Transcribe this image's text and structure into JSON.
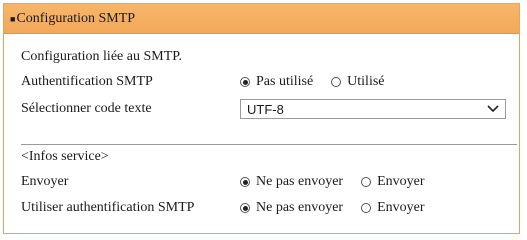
{
  "panel": {
    "title": "Configuration SMTP"
  },
  "description": "Configuration liée au SMTP.",
  "smtp_auth": {
    "label": "Authentification SMTP",
    "options": [
      "Pas utilisé",
      "Utilisé"
    ],
    "selected": "Pas utilisé"
  },
  "text_code": {
    "label": "Sélectionner code texte",
    "value": "UTF-8"
  },
  "service_info": {
    "heading": "<Infos service>"
  },
  "send": {
    "label": "Envoyer",
    "options": [
      "Ne pas envoyer",
      "Envoyer"
    ],
    "selected": "Ne pas envoyer"
  },
  "use_smtp_auth": {
    "label": "Utiliser authentification SMTP",
    "options": [
      "Ne pas envoyer",
      "Envoyer"
    ],
    "selected": "Ne pas envoyer"
  }
}
